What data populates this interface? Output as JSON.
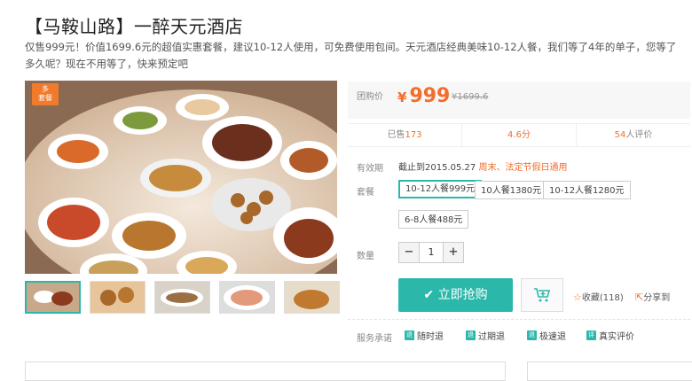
{
  "product": {
    "title": "【马鞍山路】一醉天元酒店",
    "description": "仅售999元！价值1699.6元的超值实惠套餐，建议10-12人使用，可免费使用包间。天元酒店经典美味10-12人餐，我们等了4年的单子，您等了多久呢？现在不用等了，快来预定吧",
    "badge_line1": "多",
    "badge_line2": "套餐"
  },
  "pricing": {
    "label": "团购价",
    "currency": "¥",
    "price": "999",
    "original": "¥1699.6"
  },
  "stats": {
    "sold_prefix": "已售",
    "sold": "173",
    "rating": "4.6分",
    "reviews": "54",
    "reviews_suffix": "人评价"
  },
  "validity": {
    "label": "有效期",
    "text": "截止到2015.05.27",
    "note": "周末、法定节假日通用"
  },
  "package": {
    "label": "套餐",
    "options": [
      "10-12人餐999元",
      "10人餐1380元",
      "10-12人餐1280元",
      "6-8人餐488元"
    ]
  },
  "quantity": {
    "label": "数量",
    "minus": "−",
    "value": "1",
    "plus": "+"
  },
  "actions": {
    "buy_label": "立即抢购",
    "favorite_label": "收藏",
    "favorite_count": "(118)",
    "share_label": "分享到"
  },
  "service": {
    "label": "服务承诺",
    "items": [
      "随时退",
      "过期退",
      "极速退",
      "真实评价"
    ]
  },
  "colors": {
    "accent": "#2bb8aa",
    "price": "#f36d2b"
  }
}
